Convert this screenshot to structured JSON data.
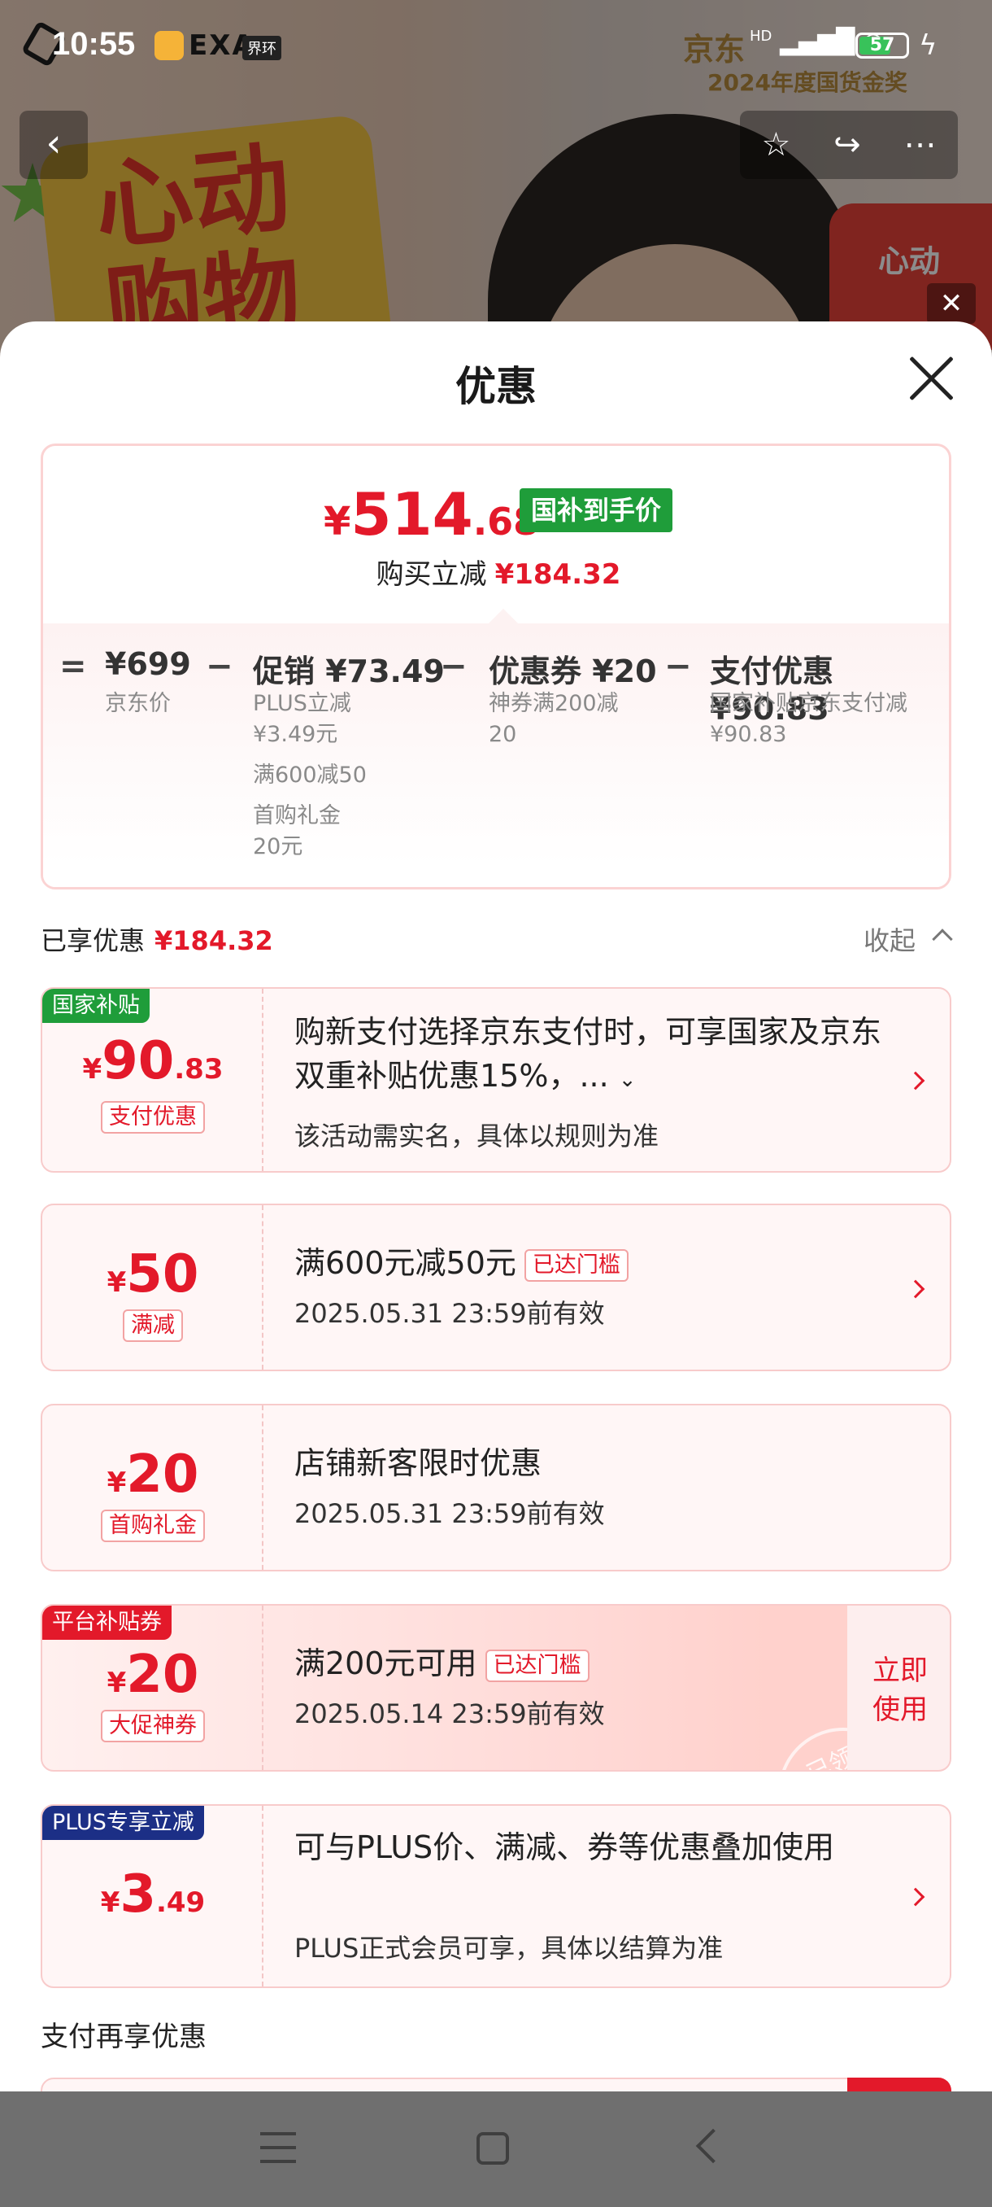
{
  "status_bar": {
    "time": "10:55",
    "brand": "EXA",
    "brand_sub": "界环",
    "network": "HD",
    "battery": "57"
  },
  "background": {
    "banner_text": "心动购物季",
    "award_line1": "京东",
    "award_line2": "2024年度国货金奖",
    "red_tag": "心动"
  },
  "sheet": {
    "title": "优惠",
    "summary": {
      "currency": "¥",
      "price_int": "514",
      "price_dec": ".68",
      "tag": "国补到手价",
      "sub_label": "购买立减",
      "sub_amount": "¥184.32",
      "calc": {
        "eq": "=",
        "minus": "−",
        "base_amount": "¥699",
        "base_label": "京东价",
        "promo_label": "促销 ¥73.49",
        "promo_lines": [
          "PLUS立减",
          "¥3.49元",
          "满600减50",
          "首购礼金",
          "20元"
        ],
        "coupon_label": "优惠券 ¥20",
        "coupon_lines": [
          "神券满200减",
          "20"
        ],
        "pay_label": "支付优惠 ¥90.83",
        "pay_lines": [
          "国家补贴京东支付减",
          "¥90.83"
        ]
      }
    },
    "enjoyed_label": "已享优惠",
    "enjoyed_amount": "¥184.32",
    "collapse_label": "收起",
    "coupons": [
      {
        "corner": "国家补贴",
        "corner_color": "#1f9d3a",
        "currency": "¥",
        "int": "90",
        "dec": ".83",
        "badge": "支付优惠",
        "title": "购新支付选择京东支付时，可享国家及京东双重补贴优惠15%，...",
        "desc": "该活动需实名，具体以规则为准"
      },
      {
        "currency": "¥",
        "int": "50",
        "badge": "满减",
        "title": "满600元减50元",
        "reached": "已达门槛",
        "desc": "2025.05.31 23:59前有效"
      },
      {
        "currency": "¥",
        "int": "20",
        "badge": "首购礼金",
        "title": "店铺新客限时优惠",
        "desc": "2025.05.31 23:59前有效"
      },
      {
        "corner": "平台补贴券",
        "corner_color": "#e3192a",
        "currency": "¥",
        "int": "20",
        "badge": "大促神券",
        "title": "满200元可用",
        "reached": "已达门槛",
        "desc": "2025.05.14 23:59前有效",
        "action": "立即使用",
        "stamp": "已领"
      },
      {
        "corner": "PLUS专享立减",
        "corner_color": "#1c2f86",
        "currency": "¥",
        "int": "3",
        "dec": ".49",
        "title": "可与PLUS价、满减、券等优惠叠加使用",
        "desc": "PLUS正式会员可享，具体以结算为准"
      }
    ],
    "pay_more_label": "支付再享优惠"
  }
}
